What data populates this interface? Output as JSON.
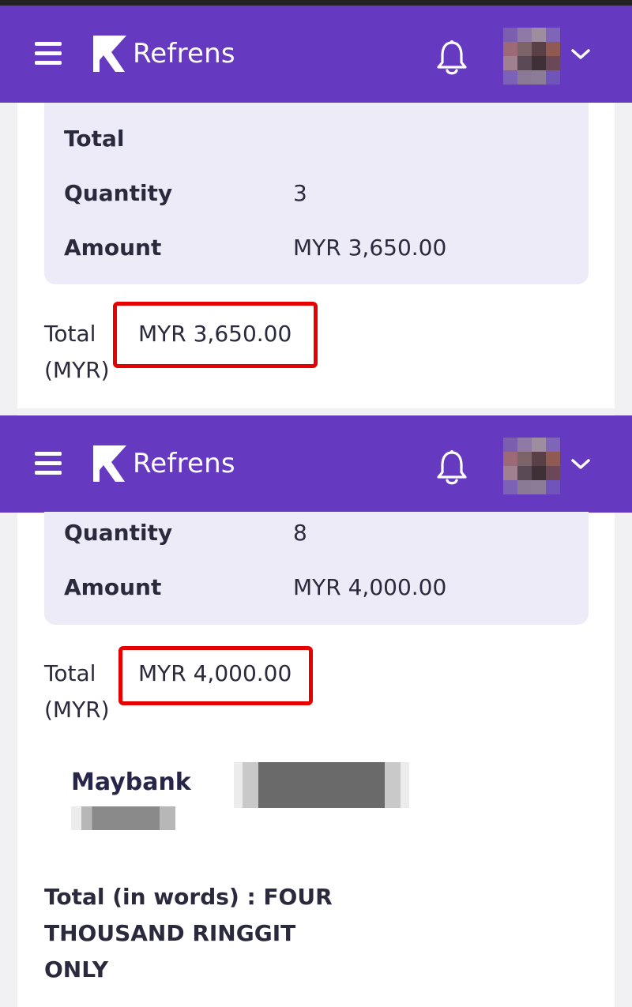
{
  "app": {
    "brand": "Refrens",
    "menu_icon": "hamburger-menu-icon",
    "notification_icon": "bell-icon",
    "account_icon": "chevron-down-icon",
    "colors": {
      "header": "#6639c1",
      "summary_bg": "#eeebf9",
      "highlight": "#e60000"
    }
  },
  "screens": [
    {
      "summary": {
        "title": "Total",
        "rows": [
          {
            "label": "Quantity",
            "value": "3"
          },
          {
            "label": "Amount",
            "value": "MYR 3,650.00"
          }
        ]
      },
      "total": {
        "label": "Total (MYR)",
        "value": "MYR 3,650.00"
      }
    },
    {
      "summary": {
        "rows": [
          {
            "label": "Quantity",
            "value": "8"
          },
          {
            "label": "Amount",
            "value": "MYR 4,000.00"
          }
        ]
      },
      "total": {
        "label": "Total (MYR)",
        "value": "MYR 4,000.00"
      },
      "bank": {
        "name": "Maybank"
      },
      "total_in_words": "Total (in words) : FOUR THOUSAND RINGGIT ONLY"
    }
  ]
}
